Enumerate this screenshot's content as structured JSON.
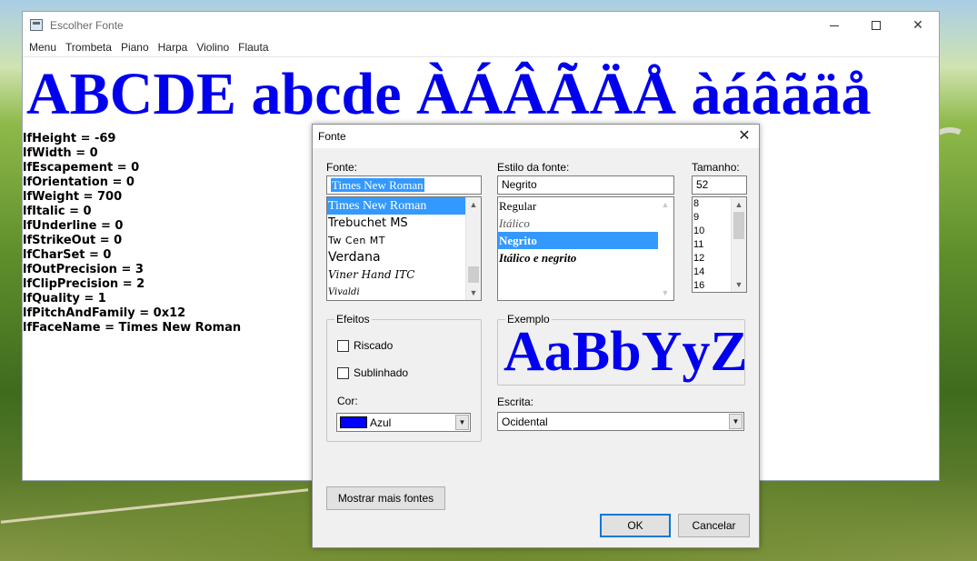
{
  "window": {
    "title": "Escolher Fonte",
    "menu": [
      "Menu",
      "Trombeta",
      "Piano",
      "Harpa",
      "Violino",
      "Flauta"
    ],
    "banner": "ABCDE abcde ÀÁÂÃÄÅ àáâãäå",
    "banner_color": "#0000ee",
    "logfont": [
      "lfHeight = -69",
      "lfWidth = 0",
      "lfEscapement = 0",
      "lfOrientation = 0",
      "lfWeight = 700",
      "lfItalic = 0",
      "lfUnderline = 0",
      "lfStrikeOut = 0",
      "lfCharSet = 0",
      "lfOutPrecision = 3",
      "lfClipPrecision = 2",
      "lfQuality = 1",
      "lfPitchAndFamily = 0x12",
      "lfFaceName = Times New Roman"
    ]
  },
  "dialog": {
    "title": "Fonte",
    "font_label": "Fonte:",
    "font_value": "Times New Roman",
    "fonts": [
      "Times New Roman",
      "Trebuchet MS",
      "Tw Cen MT",
      "Verdana",
      "Viner Hand ITC",
      "Vivaldi"
    ],
    "style_label": "Estilo da fonte:",
    "style_value": "Negrito",
    "styles": [
      "Regular",
      "Itálico",
      "Negrito",
      "Itálico e negrito"
    ],
    "size_label": "Tamanho:",
    "size_value": "52",
    "sizes": [
      "8",
      "9",
      "10",
      "11",
      "12",
      "14",
      "16"
    ],
    "effects_label": "Efeitos",
    "strikeout_label": "Riscado",
    "underline_label": "Sublinhado",
    "color_label": "Cor:",
    "color_value": "Azul",
    "color_hex": "#0000ff",
    "sample_label": "Exemplo",
    "sample_text": "AaBbYyZz",
    "script_label": "Escrita:",
    "script_value": "Ocidental",
    "more_fonts_button": "Mostrar mais fontes",
    "ok_button": "OK",
    "cancel_button": "Cancelar"
  }
}
